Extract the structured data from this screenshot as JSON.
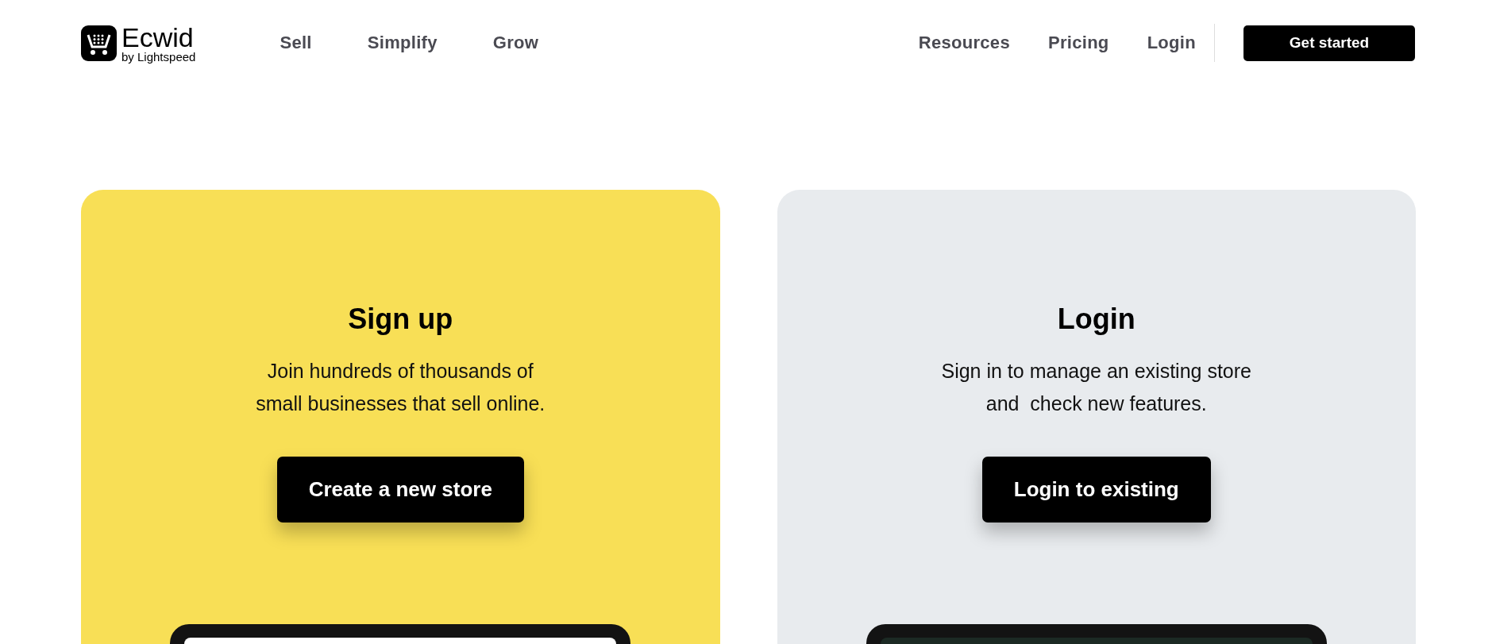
{
  "header": {
    "logo": {
      "name": "Ecwid",
      "tagline": "by Lightspeed"
    },
    "nav_left": [
      "Sell",
      "Simplify",
      "Grow"
    ],
    "nav_right": [
      "Resources",
      "Pricing",
      "Login"
    ],
    "cta": "Get started"
  },
  "cards": [
    {
      "kind": "signup",
      "title": "Sign up",
      "description": "Join hundreds of thousands of\nsmall businesses that sell online.",
      "button": "Create a new store"
    },
    {
      "kind": "login",
      "title": "Login",
      "description": "Sign in to manage an existing store\nand  check new features.",
      "button": "Login to existing"
    }
  ]
}
